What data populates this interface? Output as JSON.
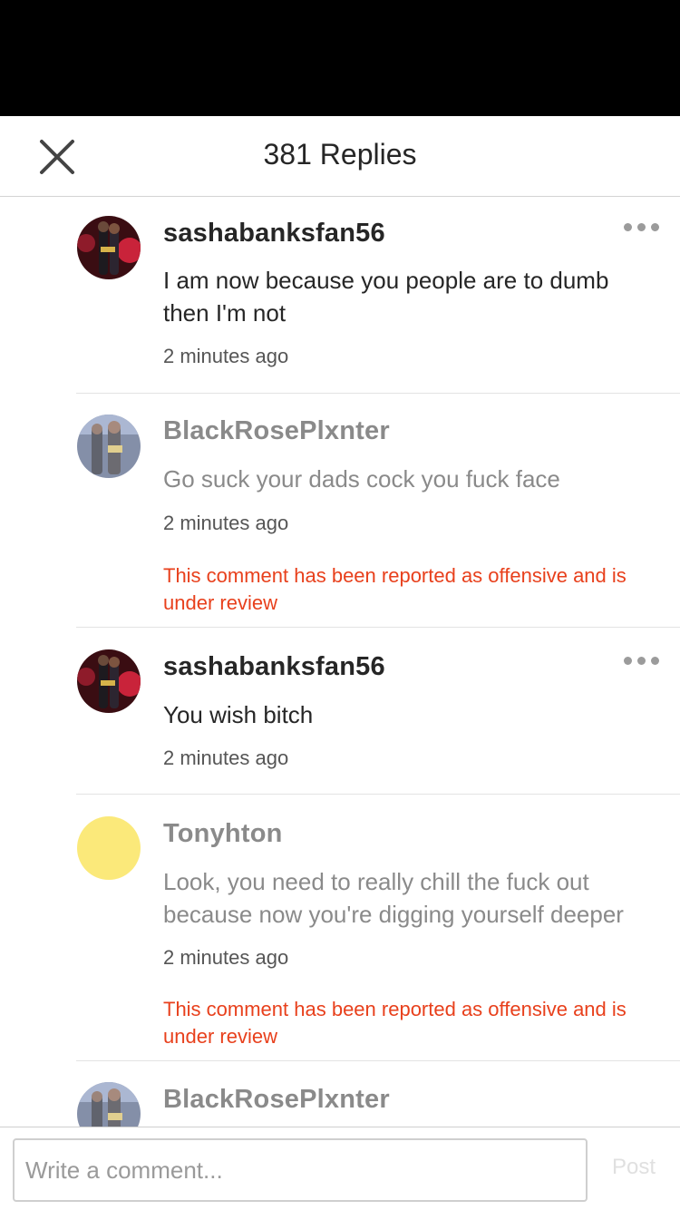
{
  "header": {
    "title": "381 Replies"
  },
  "comments": [
    {
      "username": "sashabanksfan56",
      "body": "I am now because you people are to dumb then I'm not",
      "time": "2 minutes ago",
      "reported": ""
    },
    {
      "username": "BlackRosePlxnter",
      "body": "Go suck your dads cock you fuck face",
      "time": "2 minutes ago",
      "reported": "This comment has been reported as offensive and is under review"
    },
    {
      "username": "sashabanksfan56",
      "body": "You wish bitch",
      "time": "2 minutes ago",
      "reported": ""
    },
    {
      "username": "Tonyhton",
      "body": "Look, you need to really chill the fuck out because now you're digging yourself deeper",
      "time": "2 minutes ago",
      "reported": "This comment has been reported as offensive and is under review"
    },
    {
      "username": "BlackRosePlxnter",
      "body": "",
      "time": "",
      "reported": ""
    }
  ],
  "composer": {
    "placeholder": "Write a comment...",
    "post_label": "Post"
  },
  "colors": {
    "report_text": "#e8401c",
    "avatar_yellow": "#fbe97a",
    "muted_text": "#8a8a8a"
  },
  "icons": {
    "close": "close-icon",
    "more": "more-options-icon"
  }
}
